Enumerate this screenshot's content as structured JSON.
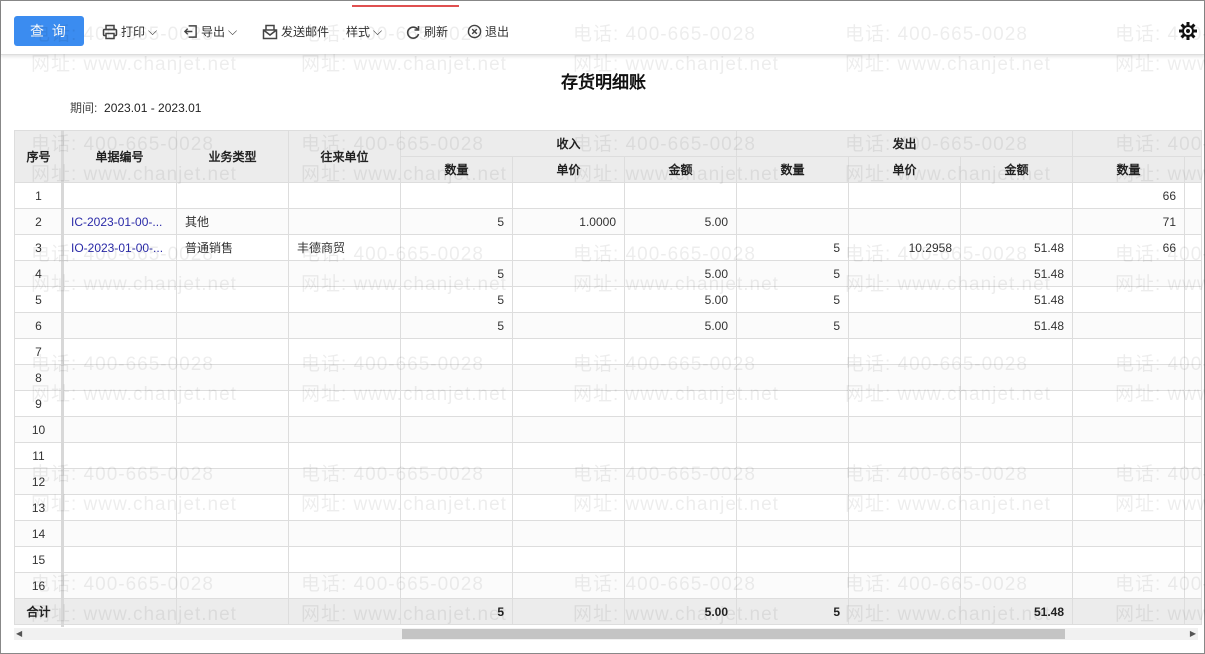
{
  "toolbar": {
    "query": "查 询",
    "print": "打印",
    "export": "导出",
    "email": "发送邮件",
    "style": "样式",
    "refresh": "刷新",
    "exit": "退出"
  },
  "report": {
    "title": "存货明细账",
    "period_label": "期间:",
    "period_value": "2023.01 - 2023.01"
  },
  "watermark": {
    "phone": "电话: 400-665-0028",
    "site": "网址: www.chanjet.net"
  },
  "table": {
    "headers": {
      "seq": "序号",
      "doc_no": "单据编号",
      "biz_type": "业务类型",
      "partner": "往来单位",
      "income": "收入",
      "outgo": "发出",
      "balance": "",
      "qty": "数量",
      "price": "单价",
      "amount": "金额"
    },
    "rows": [
      [
        "1",
        "",
        "",
        "",
        "",
        "",
        "",
        "",
        "",
        "",
        "66"
      ],
      [
        "2",
        "IC-2023-01-00-...",
        "其他",
        "",
        "5",
        "1.0000",
        "5.00",
        "",
        "",
        "",
        "71"
      ],
      [
        "3",
        "IO-2023-01-00-...",
        "普通销售",
        "丰德商贸",
        "",
        "",
        "",
        "5",
        "10.2958",
        "51.48",
        "66"
      ],
      [
        "4",
        "",
        "",
        "",
        "5",
        "",
        "5.00",
        "5",
        "",
        "51.48",
        ""
      ],
      [
        "5",
        "",
        "",
        "",
        "5",
        "",
        "5.00",
        "5",
        "",
        "51.48",
        ""
      ],
      [
        "6",
        "",
        "",
        "",
        "5",
        "",
        "5.00",
        "5",
        "",
        "51.48",
        ""
      ],
      [
        "7",
        "",
        "",
        "",
        "",
        "",
        "",
        "",
        "",
        "",
        ""
      ],
      [
        "8",
        "",
        "",
        "",
        "",
        "",
        "",
        "",
        "",
        "",
        ""
      ],
      [
        "9",
        "",
        "",
        "",
        "",
        "",
        "",
        "",
        "",
        "",
        ""
      ],
      [
        "10",
        "",
        "",
        "",
        "",
        "",
        "",
        "",
        "",
        "",
        ""
      ],
      [
        "11",
        "",
        "",
        "",
        "",
        "",
        "",
        "",
        "",
        "",
        ""
      ],
      [
        "12",
        "",
        "",
        "",
        "",
        "",
        "",
        "",
        "",
        "",
        ""
      ],
      [
        "13",
        "",
        "",
        "",
        "",
        "",
        "",
        "",
        "",
        "",
        ""
      ],
      [
        "14",
        "",
        "",
        "",
        "",
        "",
        "",
        "",
        "",
        "",
        ""
      ],
      [
        "15",
        "",
        "",
        "",
        "",
        "",
        "",
        "",
        "",
        "",
        ""
      ],
      [
        "16",
        "",
        "",
        "",
        "",
        "",
        "",
        "",
        "",
        "",
        ""
      ]
    ],
    "total": [
      "合计",
      "",
      "",
      "",
      "5",
      "",
      "5.00",
      "5",
      "",
      "51.48",
      ""
    ]
  }
}
